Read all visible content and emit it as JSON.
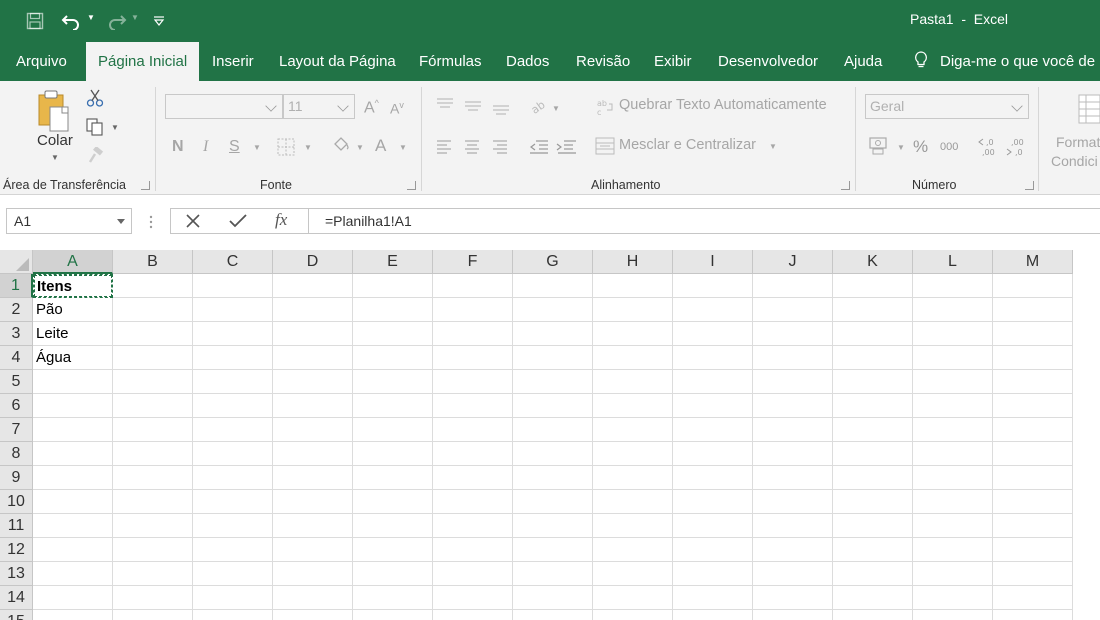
{
  "window": {
    "title": "Pasta1  -  Excel"
  },
  "qat": {
    "icons": [
      "save-icon",
      "undo-icon",
      "redo-icon",
      "customize-qat-icon"
    ]
  },
  "tabs": [
    {
      "label": "Arquivo"
    },
    {
      "label": "Página Inicial",
      "active": true
    },
    {
      "label": "Inserir"
    },
    {
      "label": "Layout da Página"
    },
    {
      "label": "Fórmulas"
    },
    {
      "label": "Dados"
    },
    {
      "label": "Revisão"
    },
    {
      "label": "Exibir"
    },
    {
      "label": "Desenvolvedor"
    },
    {
      "label": "Ajuda"
    }
  ],
  "tell_me": {
    "label": "Diga-me o que você de"
  },
  "ribbon": {
    "clipboard": {
      "paste_label": "Colar",
      "group_label": "Área de Transferência"
    },
    "font": {
      "font_name": "",
      "font_size": "11",
      "bold": "N",
      "italic": "I",
      "underline": "S",
      "font_color_glyph": "A",
      "grow_glyph": "A",
      "shrink_glyph": "A",
      "group_label": "Fonte"
    },
    "alignment": {
      "wrap_label": "Quebrar Texto Automaticamente",
      "merge_label": "Mesclar e Centralizar",
      "group_label": "Alinhamento"
    },
    "number": {
      "format": "Geral",
      "percent": "%",
      "thousands": "000",
      "inc_decimal": ",0\n,00",
      "group_label": "Número"
    },
    "styles": {
      "conditional_label_1": "Format",
      "conditional_label_2": "Condici"
    }
  },
  "formula_bar": {
    "name_box": "A1",
    "formula": "=Planilha1!A1",
    "fx": "fx"
  },
  "sheet": {
    "columns": [
      "A",
      "B",
      "C",
      "D",
      "E",
      "F",
      "G",
      "H",
      "I",
      "J",
      "K",
      "L",
      "M"
    ],
    "rows": [
      "1",
      "2",
      "3",
      "4",
      "5",
      "6",
      "7",
      "8",
      "9",
      "10",
      "11",
      "12",
      "13",
      "14",
      "15"
    ],
    "cells": {
      "A1": "Itens",
      "A2": "Pão",
      "A3": "Leite",
      "A4": "Água"
    },
    "active_cell": "A1",
    "colors": {
      "accent": "#217346"
    }
  }
}
